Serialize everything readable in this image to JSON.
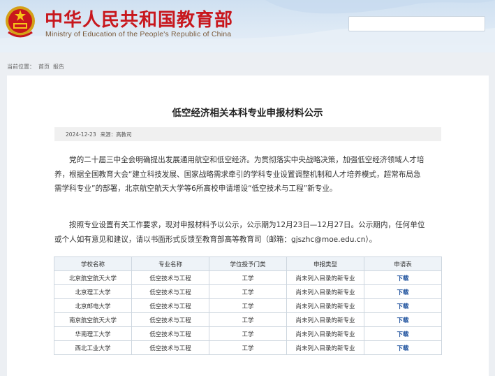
{
  "header": {
    "title": "中华人民共和国教育部",
    "subtitle": "Ministry of Education of the People's Republic of China",
    "search_placeholder": ""
  },
  "breadcrumb": {
    "prefix": "当前位置：",
    "home": "首页",
    "section": "报告"
  },
  "article": {
    "title": "低空经济相关本科专业申报材料公示",
    "date": "2024-12-23",
    "source": "来源：高教司",
    "para1": [
      "党的二十届三中全会明确提出发展通用航空和低空经济。为贯彻落实中央战略决策，加强低空经济领域人才培",
      "养，根据全国教育大会“建立科技发展、国家战略需求牵引的学科专业设置调整机制和人才培养模式，超常布局急",
      "需学科专业”的部署，北京航空航天大学等6所高校申请增设“低空技术与工程”新专业。"
    ],
    "para2": [
      "按照专业设置有关工作要求，现对申报材料予以公示，公示期为12月23日—12月27日。公示期内，任何单位",
      "或个人如有意见和建议，请以书面形式反馈至教育部高等教育司（邮箱：gjszhc@moe.edu.cn）。"
    ]
  },
  "table": {
    "headers": [
      "学校名称",
      "专业名称",
      "学位授予门类",
      "申报类型",
      "申请表"
    ],
    "rows": [
      [
        "北京航空航天大学",
        "低空技术与工程",
        "工学",
        "尚未列入目录的新专业",
        "下载"
      ],
      [
        "北京理工大学",
        "低空技术与工程",
        "工学",
        "尚未列入目录的新专业",
        "下载"
      ],
      [
        "北京邮电大学",
        "低空技术与工程",
        "工学",
        "尚未列入目录的新专业",
        "下载"
      ],
      [
        "南京航空航天大学",
        "低空技术与工程",
        "工学",
        "尚未列入目录的新专业",
        "下载"
      ],
      [
        "华南理工大学",
        "低空技术与工程",
        "工学",
        "尚未列入目录的新专业",
        "下载"
      ],
      [
        "西北工业大学",
        "低空技术与工程",
        "工学",
        "尚未列入目录的新专业",
        "下载"
      ]
    ]
  },
  "colors": {
    "title_red": "#c8171d",
    "header_blue": "#d6e5f3",
    "link_blue": "#1b4f9c"
  },
  "icons": {
    "emblem": "national-emblem-icon"
  }
}
